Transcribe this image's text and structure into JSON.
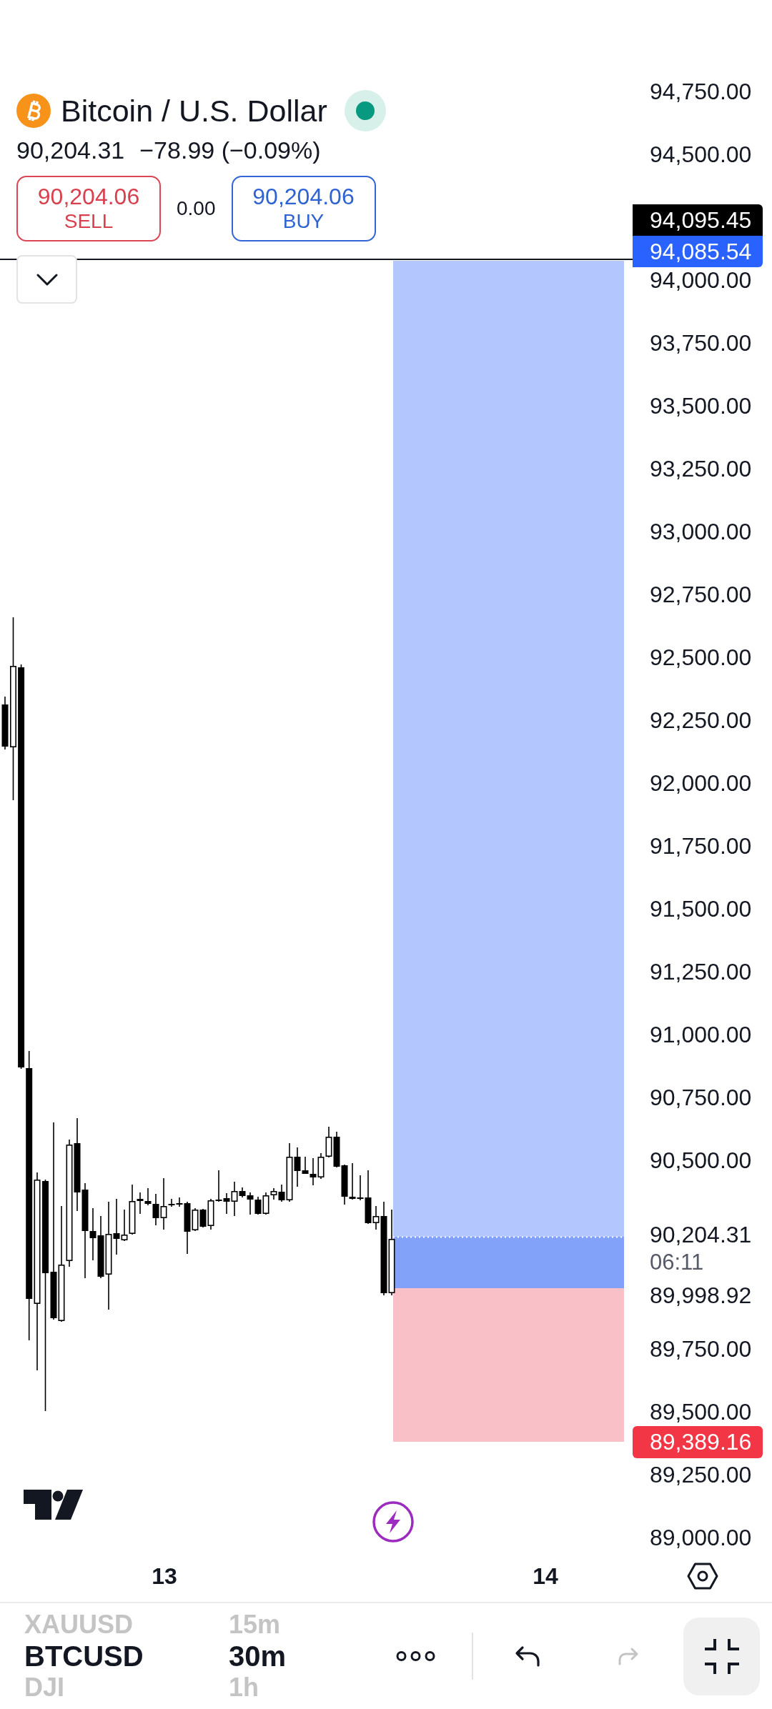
{
  "legend": {
    "title": "Bitcoin / U.S. Dollar",
    "market_open": true,
    "last_price": "90,204.31",
    "change": "−78.99 (−0.09%)"
  },
  "trade": {
    "sell": {
      "price": "90,204.06",
      "label": "SELL"
    },
    "spread": "0.00",
    "buy": {
      "price": "90,204.06",
      "label": "BUY"
    }
  },
  "price_axis": {
    "ticks": [
      "94,750.00",
      "94,500.00",
      "94,000.00",
      "93,750.00",
      "93,500.00",
      "93,250.00",
      "93,000.00",
      "92,750.00",
      "92,500.00",
      "92,250.00",
      "92,000.00",
      "91,750.00",
      "91,500.00",
      "91,250.00",
      "91,000.00",
      "90,750.00",
      "90,500.00",
      "89,750.00",
      "89,500.00",
      "89,250.00",
      "89,000.00"
    ],
    "markers": [
      {
        "kind": "line",
        "price": "94,095.45"
      },
      {
        "kind": "target",
        "price": "94,085.54"
      },
      {
        "kind": "last",
        "price": "90,204.31",
        "countdown": "06:11"
      },
      {
        "kind": "entry",
        "price": "89,998.92"
      },
      {
        "kind": "stop",
        "price": "89,389.16"
      }
    ]
  },
  "time_axis": {
    "ticks": [
      "13",
      "14"
    ]
  },
  "bottom_bar": {
    "symbols": [
      {
        "label": "XAUUSD",
        "selected": false
      },
      {
        "label": "BTCUSD",
        "selected": true
      },
      {
        "label": "DJI",
        "selected": false
      }
    ],
    "intervals": [
      {
        "label": "15m",
        "selected": false
      },
      {
        "label": "30m",
        "selected": true
      },
      {
        "label": "1h",
        "selected": false
      }
    ],
    "actions": [
      {
        "kind": "more",
        "disabled": false
      },
      {
        "kind": "undo",
        "disabled": false
      },
      {
        "kind": "redo",
        "disabled": true
      },
      {
        "kind": "collapse",
        "disabled": false
      }
    ]
  }
}
